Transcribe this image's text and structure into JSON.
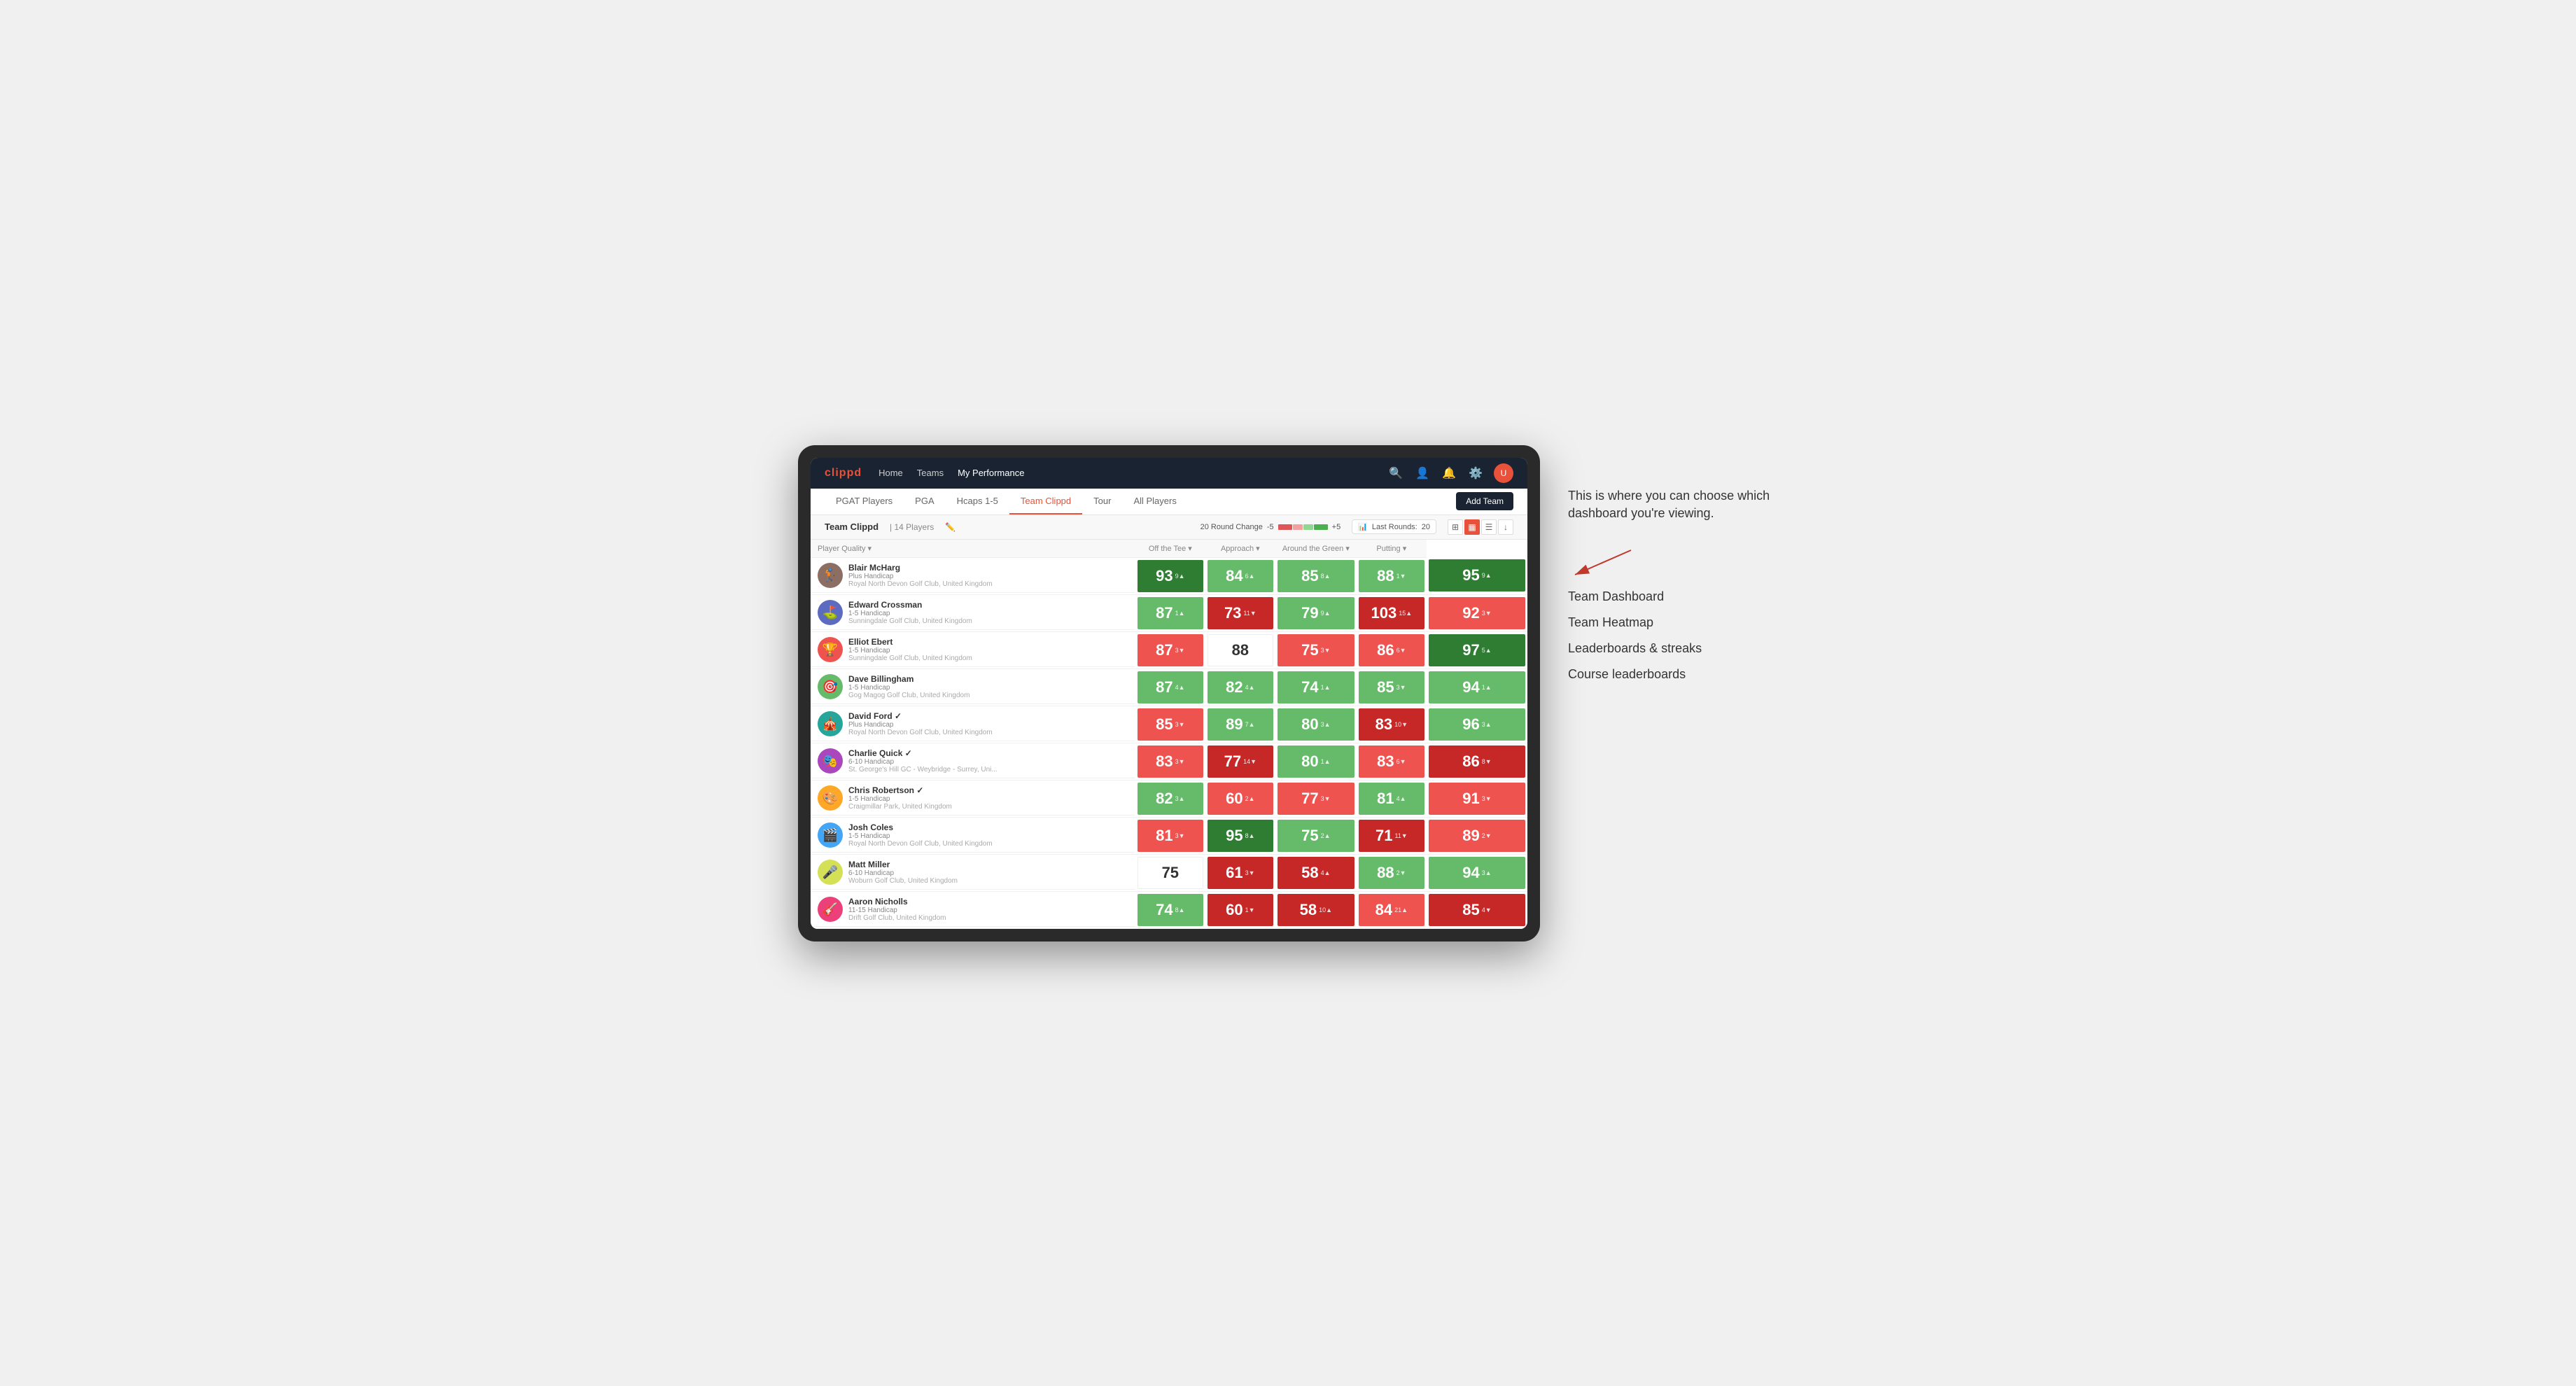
{
  "annotation": {
    "intro_text": "This is where you can choose which dashboard you're viewing.",
    "options": [
      "Team Dashboard",
      "Team Heatmap",
      "Leaderboards & streaks",
      "Course leaderboards"
    ]
  },
  "nav": {
    "logo": "clippd",
    "links": [
      "Home",
      "Teams",
      "My Performance"
    ],
    "active_link": "My Performance"
  },
  "sub_tabs": {
    "tabs": [
      "PGAT Players",
      "PGA",
      "Hcaps 1-5",
      "Team Clippd",
      "Tour",
      "All Players"
    ],
    "active": "Team Clippd",
    "add_team_label": "Add Team"
  },
  "team_bar": {
    "team_name": "Team Clippd",
    "separator": "|",
    "member_count": "14 Players",
    "round_change_label": "20 Round Change",
    "range_min": "-5",
    "range_max": "+5",
    "last_rounds_label": "Last Rounds:",
    "last_rounds_value": "20"
  },
  "table": {
    "col_headers": [
      "Player Quality ▾",
      "Off the Tee ▾",
      "Approach ▾",
      "Around the Green ▾",
      "Putting ▾"
    ],
    "players": [
      {
        "name": "Blair McHarg",
        "handicap": "Plus Handicap",
        "club": "Royal North Devon Golf Club, United Kingdom",
        "scores": [
          {
            "value": "93",
            "change": "9▲",
            "type": "green-dark"
          },
          {
            "value": "84",
            "change": "6▲",
            "type": "green-light"
          },
          {
            "value": "85",
            "change": "8▲",
            "type": "green-light"
          },
          {
            "value": "88",
            "change": "1▼",
            "type": "green-light"
          },
          {
            "value": "95",
            "change": "9▲",
            "type": "green-dark"
          }
        ]
      },
      {
        "name": "Edward Crossman",
        "handicap": "1-5 Handicap",
        "club": "Sunningdale Golf Club, United Kingdom",
        "scores": [
          {
            "value": "87",
            "change": "1▲",
            "type": "green-light"
          },
          {
            "value": "73",
            "change": "11▼",
            "type": "red-dark"
          },
          {
            "value": "79",
            "change": "9▲",
            "type": "green-light"
          },
          {
            "value": "103",
            "change": "15▲",
            "type": "red-dark"
          },
          {
            "value": "92",
            "change": "3▼",
            "type": "red-light"
          }
        ]
      },
      {
        "name": "Elliot Ebert",
        "handicap": "1-5 Handicap",
        "club": "Sunningdale Golf Club, United Kingdom",
        "scores": [
          {
            "value": "87",
            "change": "3▼",
            "type": "red-light"
          },
          {
            "value": "88",
            "change": "",
            "type": "neutral"
          },
          {
            "value": "75",
            "change": "3▼",
            "type": "red-light"
          },
          {
            "value": "86",
            "change": "6▼",
            "type": "red-light"
          },
          {
            "value": "97",
            "change": "5▲",
            "type": "green-dark"
          }
        ]
      },
      {
        "name": "Dave Billingham",
        "handicap": "1-5 Handicap",
        "club": "Gog Magog Golf Club, United Kingdom",
        "scores": [
          {
            "value": "87",
            "change": "4▲",
            "type": "green-light"
          },
          {
            "value": "82",
            "change": "4▲",
            "type": "green-light"
          },
          {
            "value": "74",
            "change": "1▲",
            "type": "green-light"
          },
          {
            "value": "85",
            "change": "3▼",
            "type": "green-light"
          },
          {
            "value": "94",
            "change": "1▲",
            "type": "green-light"
          }
        ]
      },
      {
        "name": "David Ford ✓",
        "handicap": "Plus Handicap",
        "club": "Royal North Devon Golf Club, United Kingdom",
        "scores": [
          {
            "value": "85",
            "change": "3▼",
            "type": "red-light"
          },
          {
            "value": "89",
            "change": "7▲",
            "type": "green-light"
          },
          {
            "value": "80",
            "change": "3▲",
            "type": "green-light"
          },
          {
            "value": "83",
            "change": "10▼",
            "type": "red-dark"
          },
          {
            "value": "96",
            "change": "3▲",
            "type": "green-light"
          }
        ]
      },
      {
        "name": "Charlie Quick ✓",
        "handicap": "6-10 Handicap",
        "club": "St. George's Hill GC - Weybridge - Surrey, Uni...",
        "scores": [
          {
            "value": "83",
            "change": "3▼",
            "type": "red-light"
          },
          {
            "value": "77",
            "change": "14▼",
            "type": "red-dark"
          },
          {
            "value": "80",
            "change": "1▲",
            "type": "green-light"
          },
          {
            "value": "83",
            "change": "6▼",
            "type": "red-light"
          },
          {
            "value": "86",
            "change": "8▼",
            "type": "red-dark"
          }
        ]
      },
      {
        "name": "Chris Robertson ✓",
        "handicap": "1-5 Handicap",
        "club": "Craigmillar Park, United Kingdom",
        "scores": [
          {
            "value": "82",
            "change": "3▲",
            "type": "green-light"
          },
          {
            "value": "60",
            "change": "2▲",
            "type": "red-light"
          },
          {
            "value": "77",
            "change": "3▼",
            "type": "red-light"
          },
          {
            "value": "81",
            "change": "4▲",
            "type": "green-light"
          },
          {
            "value": "91",
            "change": "3▼",
            "type": "red-light"
          }
        ]
      },
      {
        "name": "Josh Coles",
        "handicap": "1-5 Handicap",
        "club": "Royal North Devon Golf Club, United Kingdom",
        "scores": [
          {
            "value": "81",
            "change": "3▼",
            "type": "red-light"
          },
          {
            "value": "95",
            "change": "8▲",
            "type": "green-dark"
          },
          {
            "value": "75",
            "change": "2▲",
            "type": "green-light"
          },
          {
            "value": "71",
            "change": "11▼",
            "type": "red-dark"
          },
          {
            "value": "89",
            "change": "2▼",
            "type": "red-light"
          }
        ]
      },
      {
        "name": "Matt Miller",
        "handicap": "6-10 Handicap",
        "club": "Woburn Golf Club, United Kingdom",
        "scores": [
          {
            "value": "75",
            "change": "",
            "type": "neutral"
          },
          {
            "value": "61",
            "change": "3▼",
            "type": "red-dark"
          },
          {
            "value": "58",
            "change": "4▲",
            "type": "red-dark"
          },
          {
            "value": "88",
            "change": "2▼",
            "type": "green-light"
          },
          {
            "value": "94",
            "change": "3▲",
            "type": "green-light"
          }
        ]
      },
      {
        "name": "Aaron Nicholls",
        "handicap": "11-15 Handicap",
        "club": "Drift Golf Club, United Kingdom",
        "scores": [
          {
            "value": "74",
            "change": "8▲",
            "type": "green-light"
          },
          {
            "value": "60",
            "change": "1▼",
            "type": "red-dark"
          },
          {
            "value": "58",
            "change": "10▲",
            "type": "red-dark"
          },
          {
            "value": "84",
            "change": "21▲",
            "type": "red-light"
          },
          {
            "value": "85",
            "change": "4▼",
            "type": "red-dark"
          }
        ]
      }
    ]
  }
}
